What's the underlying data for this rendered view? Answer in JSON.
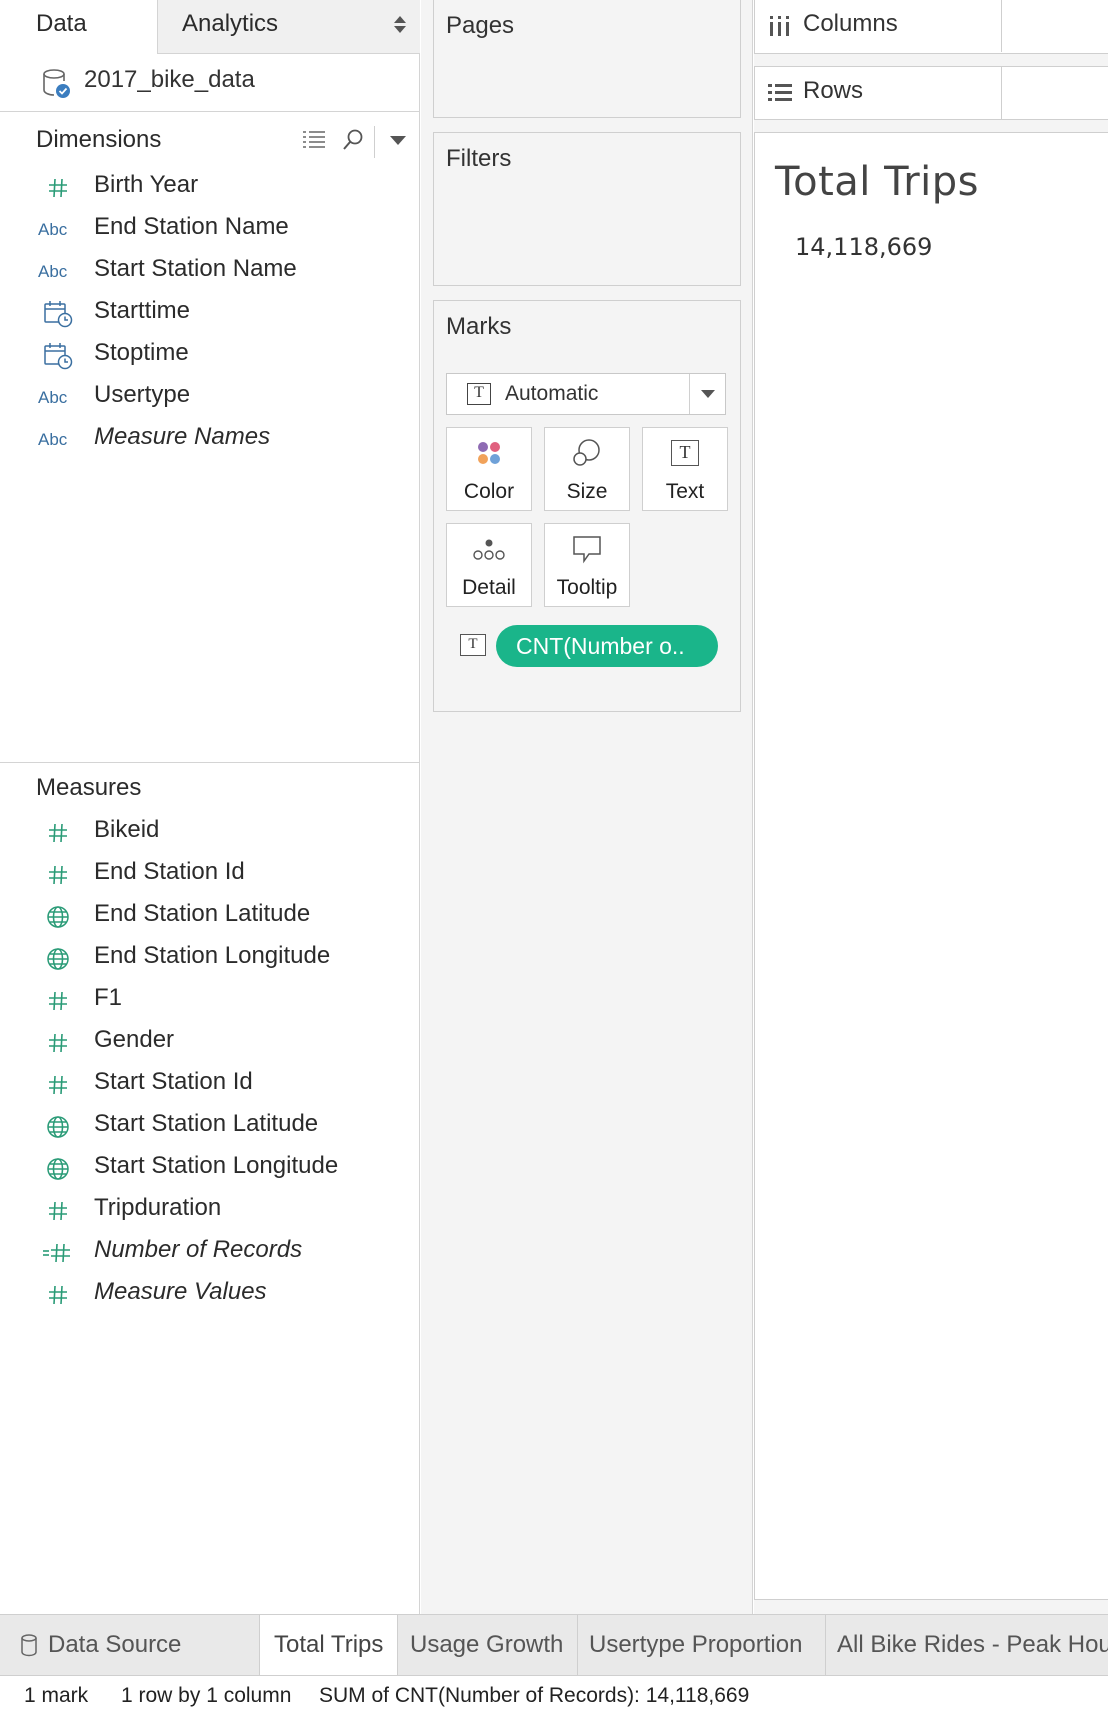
{
  "left_pane": {
    "tabs": {
      "data": "Data",
      "analytics": "Analytics"
    },
    "datasource": {
      "name": "2017_bike_data",
      "icon": "database-connected-icon"
    },
    "dimensions": {
      "title": "Dimensions",
      "fields": [
        {
          "name": "Birth Year",
          "type_icon": "hash-icon"
        },
        {
          "name": "End Station Name",
          "type_icon": "abc-icon"
        },
        {
          "name": "Start Station Name",
          "type_icon": "abc-icon"
        },
        {
          "name": "Starttime",
          "type_icon": "calendar-clock-icon"
        },
        {
          "name": "Stoptime",
          "type_icon": "calendar-clock-icon"
        },
        {
          "name": "Usertype",
          "type_icon": "abc-icon"
        },
        {
          "name": "Measure Names",
          "type_icon": "abc-icon",
          "italic": true
        }
      ]
    },
    "measures": {
      "title": "Measures",
      "fields": [
        {
          "name": "Bikeid",
          "type_icon": "hash-icon"
        },
        {
          "name": "End Station Id",
          "type_icon": "hash-icon"
        },
        {
          "name": "End Station Latitude",
          "type_icon": "globe-icon"
        },
        {
          "name": "End Station Longitude",
          "type_icon": "globe-icon"
        },
        {
          "name": "F1",
          "type_icon": "hash-icon"
        },
        {
          "name": "Gender",
          "type_icon": "hash-icon"
        },
        {
          "name": "Start Station Id",
          "type_icon": "hash-icon"
        },
        {
          "name": "Start Station Latitude",
          "type_icon": "globe-icon"
        },
        {
          "name": "Start Station Longitude",
          "type_icon": "globe-icon"
        },
        {
          "name": "Tripduration",
          "type_icon": "hash-icon"
        },
        {
          "name": "Number of Records",
          "type_icon": "calc-hash-icon",
          "italic": true
        },
        {
          "name": "Measure Values",
          "type_icon": "hash-icon",
          "italic": true
        }
      ]
    },
    "abc_label": "Abc"
  },
  "shelves": {
    "pages": "Pages",
    "filters": "Filters",
    "columns": "Columns",
    "rows": "Rows"
  },
  "marks": {
    "title": "Marks",
    "mark_type": "Automatic",
    "buttons": [
      "Color",
      "Size",
      "Text",
      "Detail",
      "Tooltip"
    ],
    "pill": "CNT(Number o..",
    "t_glyph": "T"
  },
  "viz": {
    "title": "Total Trips",
    "value": "14,118,669"
  },
  "sheet_tabs": [
    "Data Source",
    "Total Trips",
    "Usage Growth",
    "Usertype Proportion",
    "All Bike Rides - Peak Hou"
  ],
  "active_tab": "Total Trips",
  "status": {
    "marks": "1 mark",
    "dims": "1 row by 1 column",
    "sum": "SUM of CNT(Number of Records): 14,118,669"
  },
  "colors": {
    "accent_green": "#1ab58a",
    "measure_icon": "#2a9b77",
    "dimension_icon": "#3a6fa0"
  }
}
